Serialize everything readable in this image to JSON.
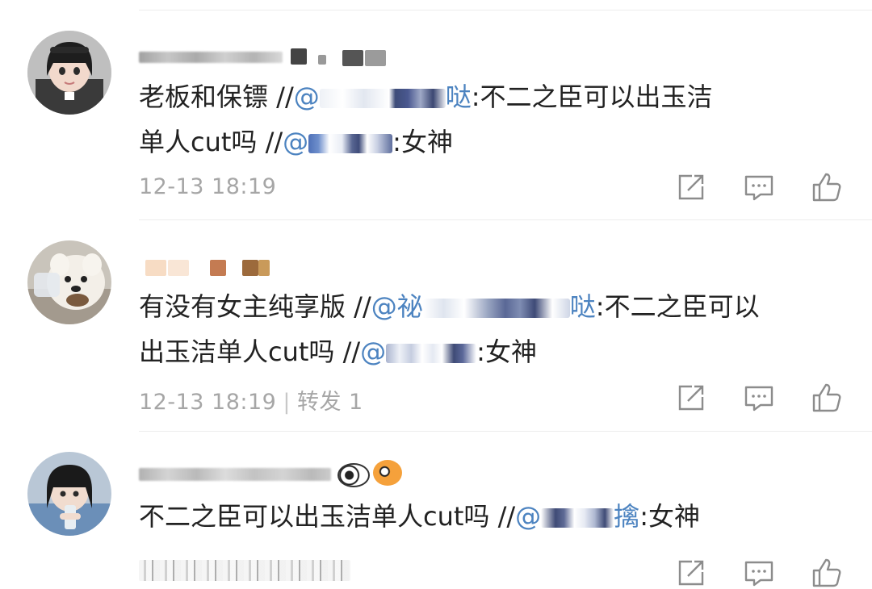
{
  "colors": {
    "text": "#222222",
    "mention": "#4c83c0",
    "meta": "#a6a6a6",
    "icon": "#8c8c8c",
    "divider": "#ececec"
  },
  "comments": [
    {
      "text_before": "老板和保镖 //",
      "mention_1": "@",
      "mention_1_suffix": "哒",
      "text_mid": ":不二之臣可以出玉洁",
      "text_line2_before": "单人cut吗 //",
      "mention_2": "@",
      "mention_2_suffix": "",
      "text_after": ":女神",
      "time": "12-13 18:19",
      "repost": "",
      "icons": [
        "share-icon",
        "comment-icon",
        "like-icon"
      ]
    },
    {
      "text_before": "有没有女主纯享版 //",
      "mention_1": "@祕",
      "mention_1_suffix": "哒",
      "text_mid": ":不二之臣可以",
      "text_line2_before": "出玉洁单人cut吗 //",
      "mention_2": "@",
      "mention_2_suffix": "",
      "text_after": ":女神",
      "time": "12-13 18:19",
      "repost": "转发 1",
      "icons": [
        "share-icon",
        "comment-icon",
        "like-icon"
      ]
    },
    {
      "text_before": "不二之臣可以出玉洁单人cut吗 //",
      "mention_1": "@",
      "mention_1_suffix": "擒",
      "text_after": ":女神",
      "time": "",
      "repost": "",
      "icons": [
        "share-icon",
        "comment-icon",
        "like-icon"
      ]
    }
  ]
}
